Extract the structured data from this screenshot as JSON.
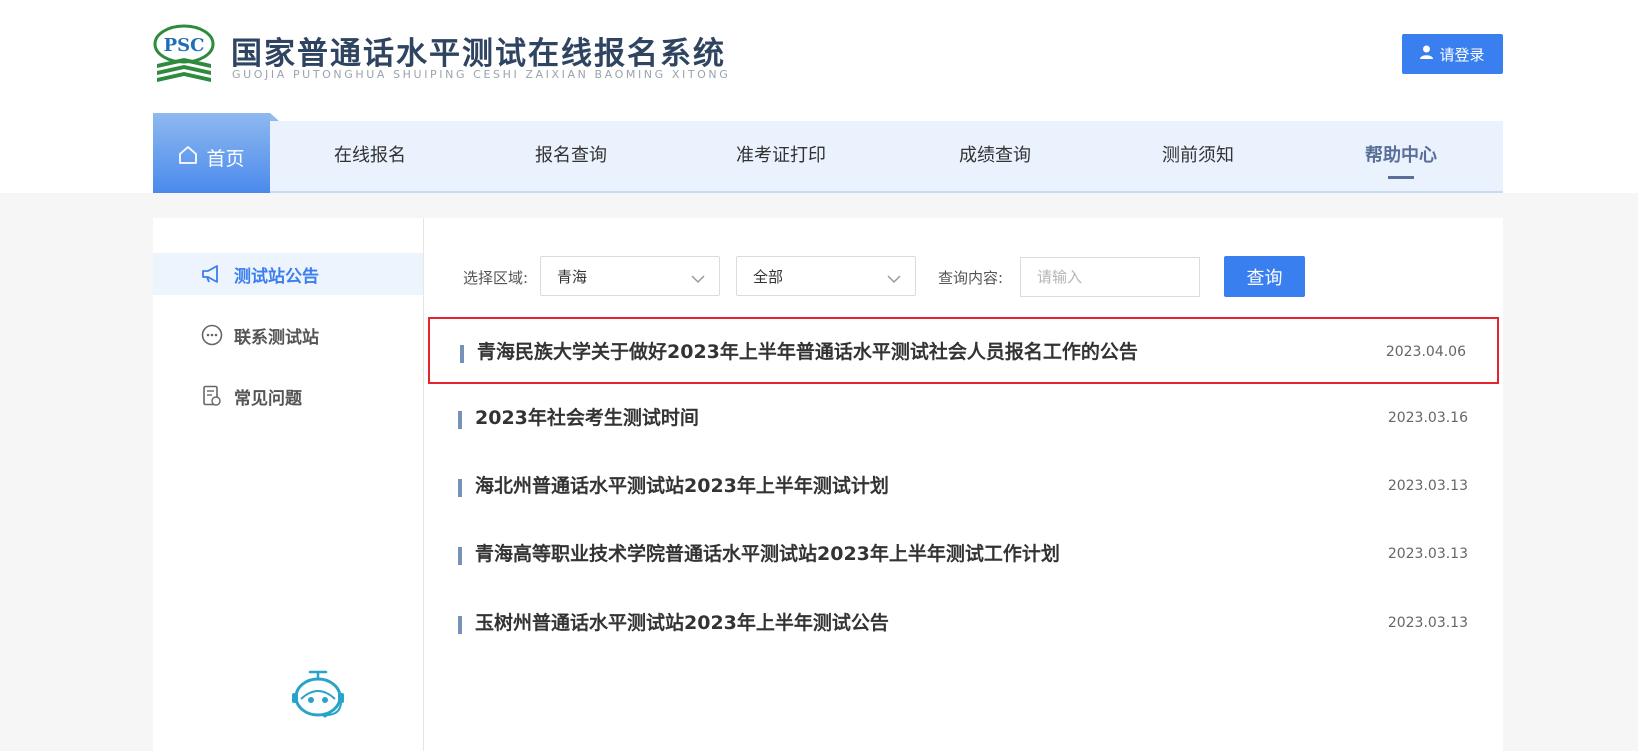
{
  "header": {
    "logo_text": "PSC",
    "title": "国家普通话水平测试在线报名系统",
    "subtitle": "GUOJIA PUTONGHUA SHUIPING CESHI ZAIXIAN BAOMING XITONG",
    "login_label": "请登录"
  },
  "nav": {
    "home": "首页",
    "items": [
      "在线报名",
      "报名查询",
      "准考证打印",
      "成绩查询",
      "测前须知",
      "帮助中心"
    ]
  },
  "sidebar": {
    "items": [
      "测试站公告",
      "联系测试站",
      "常见问题"
    ]
  },
  "filters": {
    "region_label": "选择区域:",
    "region_value": "青海",
    "category_value": "全部",
    "query_label": "查询内容:",
    "query_placeholder": "请输入",
    "query_button": "查询"
  },
  "news": [
    {
      "title": "青海民族大学关于做好2023年上半年普通话水平测试社会人员报名工作的公告",
      "date": "2023.04.06"
    },
    {
      "title": "2023年社会考生测试时间",
      "date": "2023.03.16"
    },
    {
      "title": "海北州普通话水平测试站2023年上半年测试计划",
      "date": "2023.03.13"
    },
    {
      "title": "青海高等职业技术学院普通话水平测试站2023年上半年测试工作计划",
      "date": "2023.03.13"
    },
    {
      "title": "玉树州普通话水平测试站2023年上半年测试公告",
      "date": "2023.03.13"
    }
  ],
  "colors": {
    "accent": "#3a7ff0",
    "nav_bg": "#eaf2fd",
    "highlight_border": "#e5242b"
  }
}
